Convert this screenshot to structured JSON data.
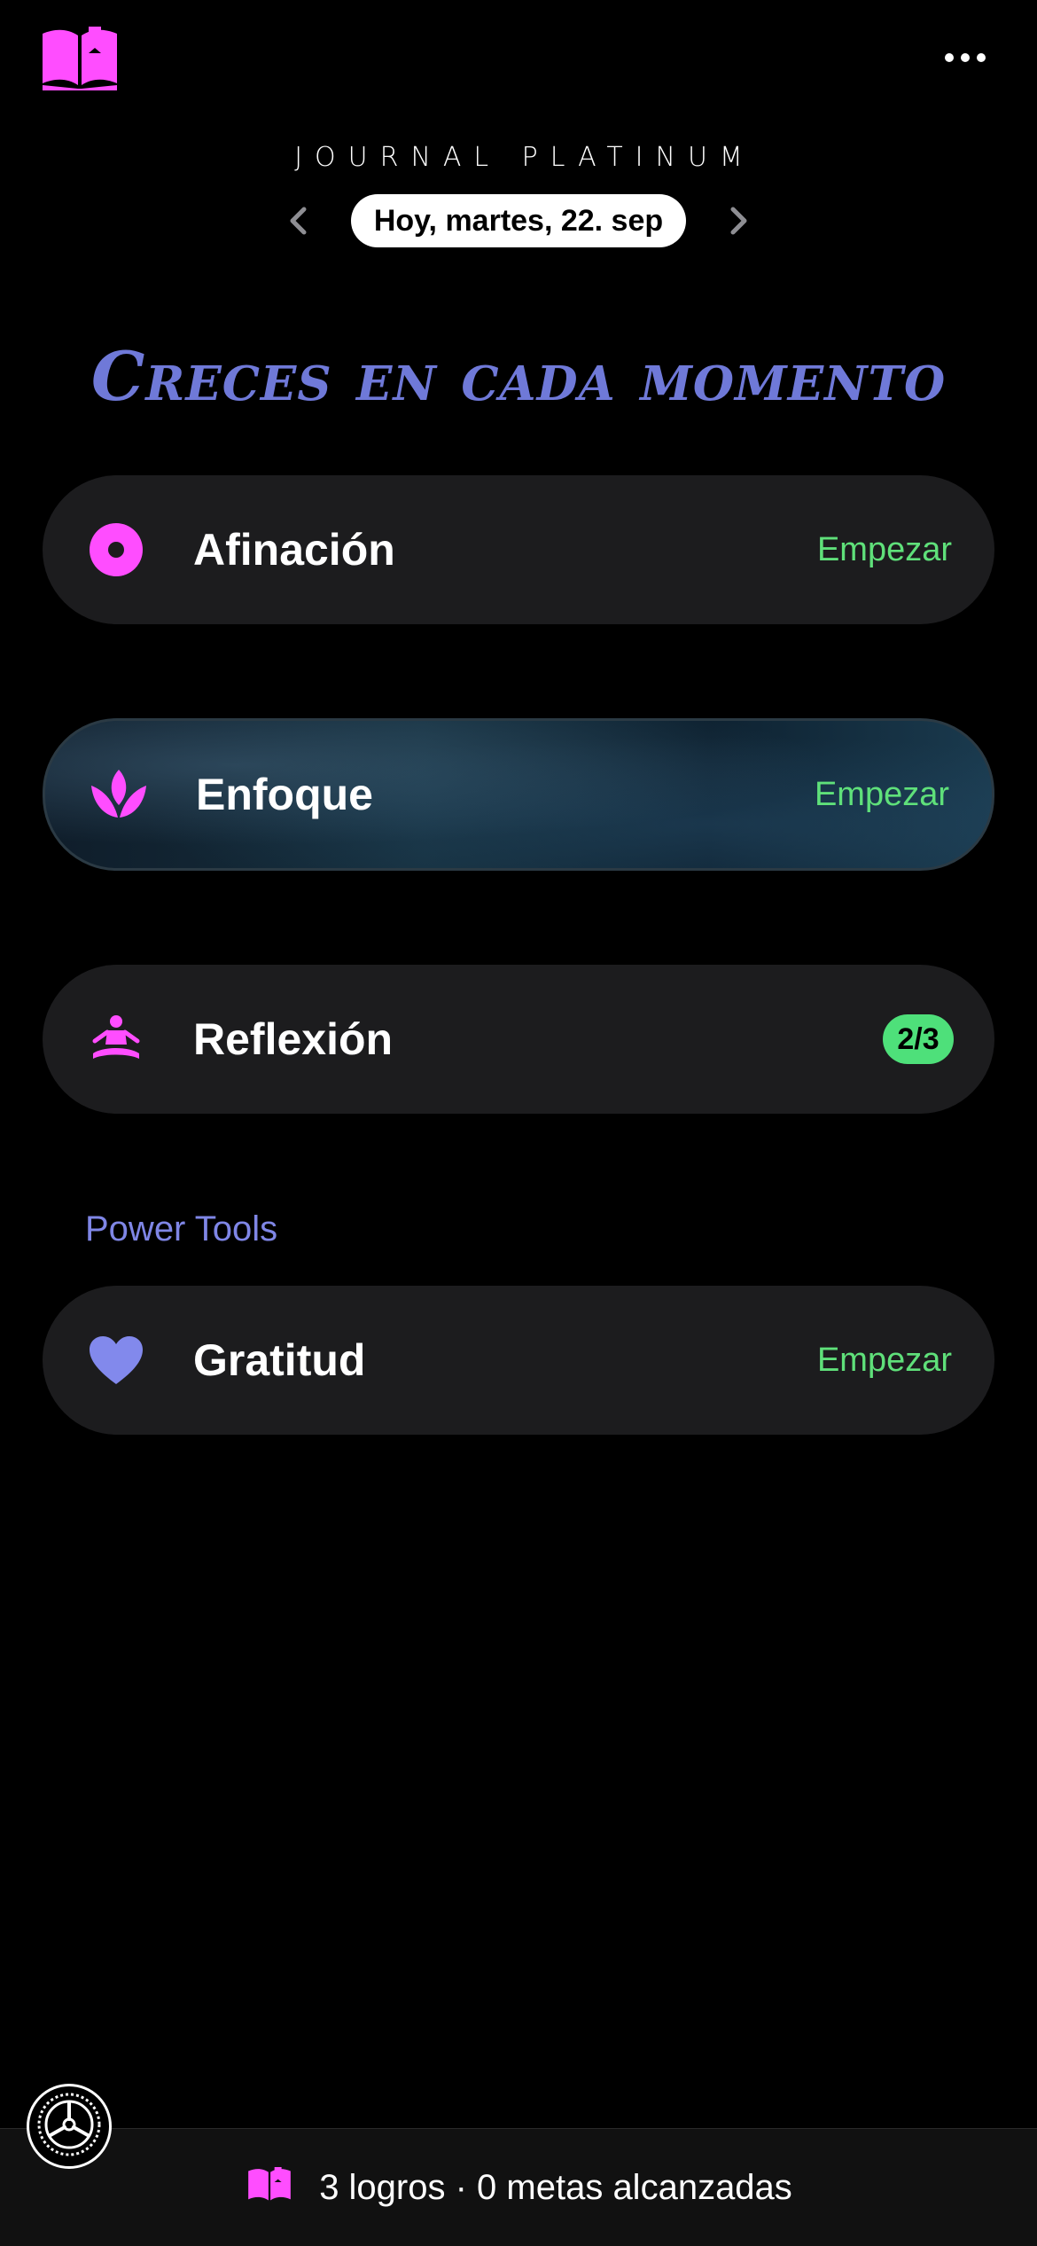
{
  "colors": {
    "accent": "#ff4dff",
    "success": "#5fe07a",
    "tagline": "#6f79d8",
    "section": "#7f86e6",
    "card_bg": "#1c1c1e"
  },
  "header": {
    "logo_icon": "open-book-icon",
    "more_icon": "ellipsis-icon",
    "app_title": "JOURNAL PLATINUM",
    "date_label": "Hoy, martes, 22. sep",
    "prev_icon": "chevron-left-icon",
    "next_icon": "chevron-right-icon"
  },
  "tagline": "Creces en cada momento",
  "cards": [
    {
      "label": "Afinación",
      "icon": "record-circle-icon",
      "action": "Empezar"
    },
    {
      "label": "Enfoque",
      "icon": "lotus-icon",
      "action": "Empezar"
    },
    {
      "label": "Reflexión",
      "icon": "meditation-icon",
      "badge": "2/3"
    }
  ],
  "power_tools": {
    "title": "Power Tools",
    "items": [
      {
        "label": "Gratitud",
        "icon": "heart-icon",
        "action": "Empezar"
      }
    ]
  },
  "footer": {
    "icon": "open-book-icon",
    "summary": "3 logros · 0 metas alcanzadas",
    "settings_icon": "gear-icon"
  }
}
